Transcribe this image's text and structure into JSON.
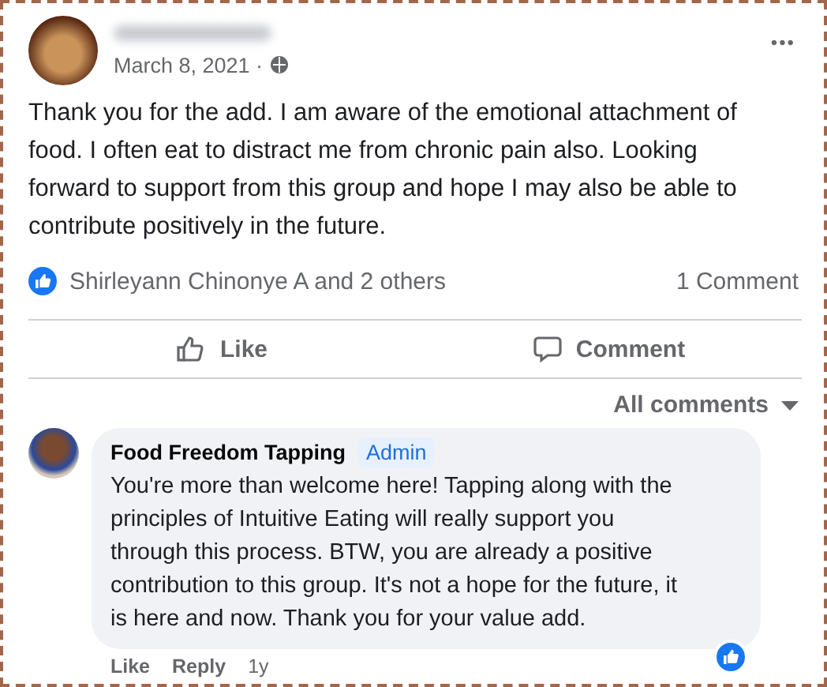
{
  "post": {
    "date": "March 8, 2021 ·",
    "more": "•••",
    "text": "Thank you for the add. I am aware of the emotional attachment of food. I often eat to distract me from chronic pain also. Looking forward to support from this group and hope I may also be able to contribute positively in the future."
  },
  "reactions": {
    "names": "Shirleyann Chinonye A and 2 others",
    "comments": "1 Comment"
  },
  "actions": [
    {
      "kind": "like",
      "label": "Like"
    },
    {
      "kind": "comment",
      "label": "Comment"
    }
  ],
  "sort": {
    "label": "All comments"
  },
  "comment": {
    "author": "Food Freedom Tapping",
    "badge": "Admin",
    "text": "You're more than welcome here! Tapping along with the principles of Intuitive Eating will really support you through this process. BTW, you are already a positive contribution to this group. It's not a hope for the future, it is here and now. Thank you for your value add.",
    "liked": true,
    "links": [
      {
        "kind": "like",
        "label": "Like"
      },
      {
        "kind": "reply",
        "label": "Reply"
      },
      {
        "kind": "time",
        "label": "1y"
      }
    ]
  }
}
